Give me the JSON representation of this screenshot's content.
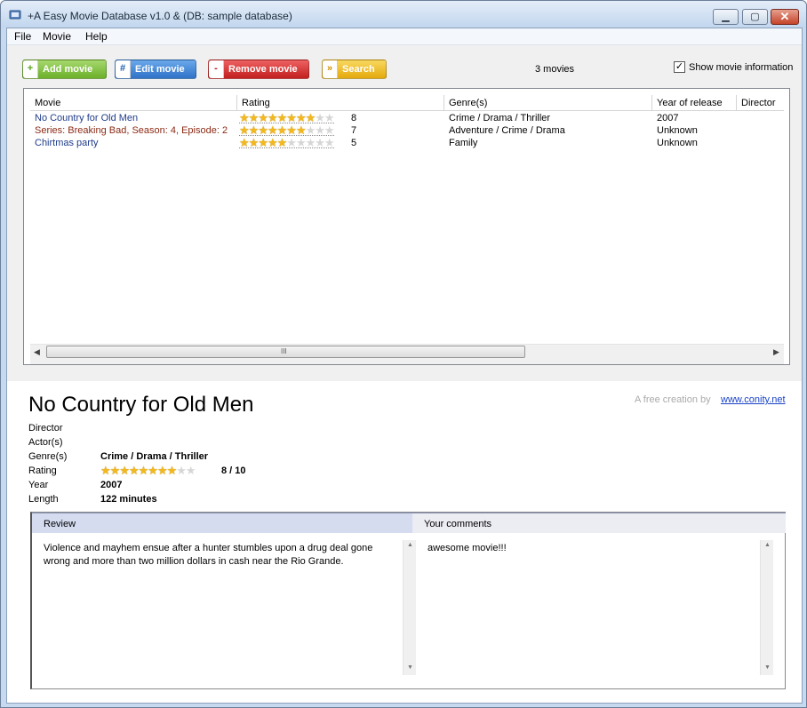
{
  "window": {
    "title": "+A Easy Movie Database v1.0 & (DB: sample database)",
    "minimize_icon": "minimize-icon",
    "maximize_icon": "maximize-icon",
    "close_icon": "close-icon"
  },
  "menu": {
    "file": "File",
    "movie": "Movie",
    "help": "Help"
  },
  "toolbar": {
    "add": {
      "icon": "+",
      "label": "Add movie"
    },
    "edit": {
      "icon": "#",
      "label": "Edit movie"
    },
    "remove": {
      "icon": "-",
      "label": "Remove movie"
    },
    "search": {
      "icon": "»",
      "label": "Search"
    },
    "movie_count": "3 movies",
    "show_info_label": "Show movie information",
    "show_info_checked": true
  },
  "list": {
    "columns": [
      "Movie",
      "Rating",
      "Genre(s)",
      "Year of release",
      "Director"
    ],
    "rows": [
      {
        "movie": "No Country for Old Men",
        "rating": 8,
        "rating_label": "8",
        "genre": "Crime / Drama / Thriller",
        "year": "2007",
        "color": "#1f3c8a"
      },
      {
        "movie": "Series: Breaking Bad, Season: 4, Episode: 2",
        "rating": 7,
        "rating_label": "7",
        "genre": "Adventure / Crime / Drama",
        "year": "Unknown",
        "color": "#8b2a14"
      },
      {
        "movie": "Chirtmas party",
        "rating": 5,
        "rating_label": "5",
        "genre": "Family",
        "year": "Unknown",
        "color": "#1f3c8a"
      }
    ],
    "max_rating": 10,
    "scroll_grip": "III"
  },
  "details": {
    "title": "No Country for Old Men",
    "credit_text": "A free creation by",
    "credit_link": "www.conity.net",
    "labels": {
      "director": "Director",
      "actors": "Actor(s)",
      "genres": "Genre(s)",
      "rating": "Rating",
      "year": "Year",
      "length": "Length"
    },
    "values": {
      "director": "",
      "actors": "",
      "genres": "Crime / Drama / Thriller",
      "rating": 8,
      "rating_text": "8 / 10",
      "year": "2007",
      "length": "122 minutes"
    }
  },
  "review_panel": {
    "review_tab": "Review",
    "comments_tab": "Your comments",
    "review_text": "Violence and mayhem ensue after a hunter stumbles upon a drug deal gone wrong and more than two million dollars in cash near the Rio Grande.",
    "comments_text": "awesome movie!!!"
  }
}
